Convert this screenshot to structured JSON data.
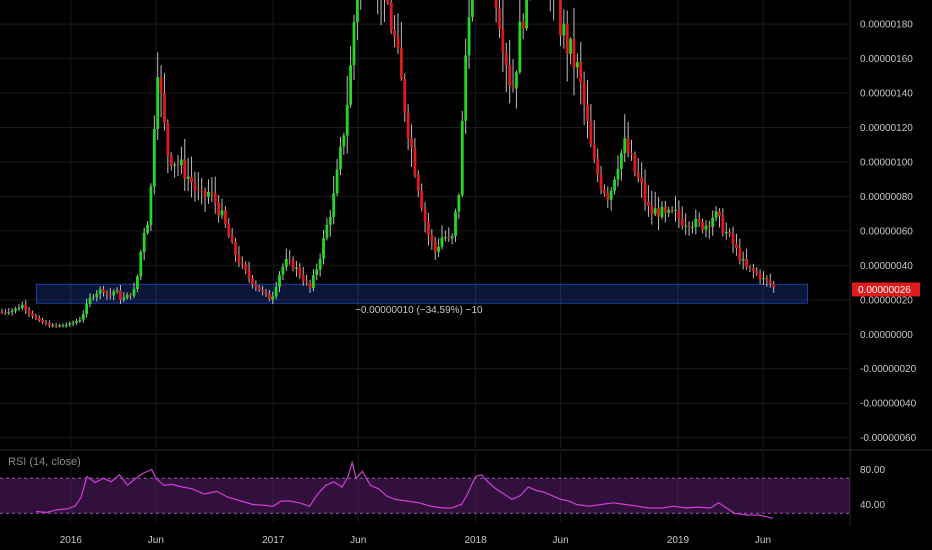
{
  "chart_data": {
    "type": "candlestick",
    "y_ticks": [
      "0.00000180",
      "0.00000160",
      "0.00000140",
      "0.00000120",
      "0.00000100",
      "0.00000080",
      "0.00000060",
      "0.00000040",
      "0.00000020",
      "0.00000000",
      "-0.00000020",
      "-0.00000040",
      "-0.00000060"
    ],
    "y_tick_values": [
      180,
      160,
      140,
      120,
      100,
      80,
      60,
      40,
      20,
      0,
      -20,
      -40,
      -60
    ],
    "ylim": [
      -66,
      194
    ],
    "x_labels": [
      "2016",
      "Jun",
      "2017",
      "Jun",
      "2018",
      "Jun",
      "2019",
      "Jun"
    ],
    "x_label_months": [
      2016.0,
      2016.42,
      2017.0,
      2017.42,
      2018.0,
      2018.42,
      2019.0,
      2019.42
    ],
    "xlim": [
      2015.65,
      2019.85
    ],
    "last_price_label": "0.00000026",
    "last_price_value": 26,
    "up_color": "#22d822",
    "down_color": "#e01b1b",
    "measure": {
      "label": "−0.00000010 (−34.59%) −10",
      "x_start": 2015.83,
      "x_end": 2019.64,
      "y_top": 29,
      "y_bottom": 18,
      "color": "#2962ff"
    },
    "close_path": [
      [
        2015.66,
        13
      ],
      [
        2015.72,
        14
      ],
      [
        2015.76,
        17
      ],
      [
        2015.8,
        12
      ],
      [
        2015.84,
        8
      ],
      [
        2015.9,
        5
      ],
      [
        2015.95,
        5
      ],
      [
        2016.0,
        6
      ],
      [
        2016.05,
        9
      ],
      [
        2016.09,
        20
      ],
      [
        2016.12,
        24
      ],
      [
        2016.16,
        26
      ],
      [
        2016.19,
        22
      ],
      [
        2016.22,
        26
      ],
      [
        2016.25,
        20
      ],
      [
        2016.28,
        22
      ],
      [
        2016.32,
        26
      ],
      [
        2016.36,
        60
      ],
      [
        2016.39,
        70
      ],
      [
        2016.41,
        120
      ],
      [
        2016.43,
        160
      ],
      [
        2016.45,
        130
      ],
      [
        2016.48,
        105
      ],
      [
        2016.52,
        100
      ],
      [
        2016.56,
        95
      ],
      [
        2016.6,
        88
      ],
      [
        2016.64,
        78
      ],
      [
        2016.68,
        82
      ],
      [
        2016.72,
        76
      ],
      [
        2016.76,
        64
      ],
      [
        2016.8,
        50
      ],
      [
        2016.85,
        38
      ],
      [
        2016.9,
        30
      ],
      [
        2016.95,
        24
      ],
      [
        2016.99,
        20
      ],
      [
        2017.03,
        35
      ],
      [
        2017.06,
        42
      ],
      [
        2017.1,
        40
      ],
      [
        2017.14,
        34
      ],
      [
        2017.18,
        26
      ],
      [
        2017.22,
        40
      ],
      [
        2017.26,
        60
      ],
      [
        2017.3,
        80
      ],
      [
        2017.34,
        110
      ],
      [
        2017.38,
        150
      ],
      [
        2017.41,
        200
      ],
      [
        2017.44,
        230
      ],
      [
        2017.48,
        220
      ],
      [
        2017.52,
        210
      ],
      [
        2017.56,
        195
      ],
      [
        2017.6,
        170
      ],
      [
        2017.64,
        140
      ],
      [
        2017.68,
        110
      ],
      [
        2017.72,
        85
      ],
      [
        2017.76,
        60
      ],
      [
        2017.8,
        48
      ],
      [
        2017.84,
        58
      ],
      [
        2017.88,
        52
      ],
      [
        2017.92,
        85
      ],
      [
        2017.95,
        160
      ],
      [
        2017.98,
        220
      ],
      [
        2018.02,
        240
      ],
      [
        2018.06,
        230
      ],
      [
        2018.1,
        200
      ],
      [
        2018.14,
        170
      ],
      [
        2018.18,
        140
      ],
      [
        2018.22,
        175
      ],
      [
        2018.26,
        210
      ],
      [
        2018.3,
        230
      ],
      [
        2018.34,
        215
      ],
      [
        2018.38,
        205
      ],
      [
        2018.42,
        180
      ],
      [
        2018.46,
        165
      ],
      [
        2018.5,
        155
      ],
      [
        2018.54,
        130
      ],
      [
        2018.58,
        100
      ],
      [
        2018.62,
        88
      ],
      [
        2018.66,
        80
      ],
      [
        2018.7,
        100
      ],
      [
        2018.74,
        110
      ],
      [
        2018.78,
        96
      ],
      [
        2018.82,
        85
      ],
      [
        2018.86,
        70
      ],
      [
        2018.9,
        72
      ],
      [
        2018.94,
        68
      ],
      [
        2018.98,
        70
      ],
      [
        2019.02,
        66
      ],
      [
        2019.06,
        66
      ],
      [
        2019.1,
        63
      ],
      [
        2019.14,
        64
      ],
      [
        2019.18,
        70
      ],
      [
        2019.22,
        62
      ],
      [
        2019.26,
        55
      ],
      [
        2019.3,
        46
      ],
      [
        2019.34,
        38
      ],
      [
        2019.38,
        36
      ],
      [
        2019.42,
        32
      ],
      [
        2019.46,
        29
      ],
      [
        2019.48,
        26
      ]
    ],
    "rsi": {
      "title": "RSI (14, close)",
      "y_ticks": [
        "80.00",
        "40.00"
      ],
      "y_tick_values": [
        80,
        40
      ],
      "upper_band": 70,
      "lower_band": 30,
      "ylim": [
        20,
        100
      ],
      "line_color": "#d23ddb",
      "band_color": "#5a1f6e",
      "values": [
        [
          2015.83,
          32
        ],
        [
          2015.88,
          31
        ],
        [
          2015.93,
          34
        ],
        [
          2015.98,
          35
        ],
        [
          2016.02,
          38
        ],
        [
          2016.05,
          48
        ],
        [
          2016.08,
          72
        ],
        [
          2016.12,
          65
        ],
        [
          2016.16,
          70
        ],
        [
          2016.2,
          66
        ],
        [
          2016.24,
          74
        ],
        [
          2016.28,
          62
        ],
        [
          2016.32,
          70
        ],
        [
          2016.36,
          76
        ],
        [
          2016.4,
          80
        ],
        [
          2016.42,
          70
        ],
        [
          2016.46,
          62
        ],
        [
          2016.5,
          63
        ],
        [
          2016.55,
          60
        ],
        [
          2016.6,
          58
        ],
        [
          2016.66,
          52
        ],
        [
          2016.72,
          55
        ],
        [
          2016.78,
          48
        ],
        [
          2016.84,
          44
        ],
        [
          2016.9,
          40
        ],
        [
          2016.96,
          39
        ],
        [
          2017.0,
          38
        ],
        [
          2017.04,
          44
        ],
        [
          2017.08,
          44
        ],
        [
          2017.13,
          42
        ],
        [
          2017.18,
          38
        ],
        [
          2017.22,
          52
        ],
        [
          2017.26,
          62
        ],
        [
          2017.3,
          66
        ],
        [
          2017.34,
          60
        ],
        [
          2017.37,
          72
        ],
        [
          2017.39,
          88
        ],
        [
          2017.41,
          70
        ],
        [
          2017.44,
          78
        ],
        [
          2017.48,
          62
        ],
        [
          2017.52,
          58
        ],
        [
          2017.56,
          50
        ],
        [
          2017.6,
          46
        ],
        [
          2017.66,
          44
        ],
        [
          2017.72,
          42
        ],
        [
          2017.78,
          38
        ],
        [
          2017.84,
          36
        ],
        [
          2017.88,
          36
        ],
        [
          2017.93,
          40
        ],
        [
          2017.96,
          52
        ],
        [
          2018.0,
          72
        ],
        [
          2018.03,
          74
        ],
        [
          2018.06,
          66
        ],
        [
          2018.1,
          58
        ],
        [
          2018.14,
          52
        ],
        [
          2018.18,
          46
        ],
        [
          2018.22,
          50
        ],
        [
          2018.26,
          60
        ],
        [
          2018.3,
          56
        ],
        [
          2018.34,
          54
        ],
        [
          2018.38,
          50
        ],
        [
          2018.42,
          46
        ],
        [
          2018.46,
          44
        ],
        [
          2018.5,
          40
        ],
        [
          2018.56,
          38
        ],
        [
          2018.62,
          40
        ],
        [
          2018.68,
          42
        ],
        [
          2018.74,
          40
        ],
        [
          2018.8,
          38
        ],
        [
          2018.86,
          36
        ],
        [
          2018.92,
          36
        ],
        [
          2018.98,
          38
        ],
        [
          2019.04,
          36
        ],
        [
          2019.1,
          37
        ],
        [
          2019.16,
          36
        ],
        [
          2019.2,
          42
        ],
        [
          2019.24,
          36
        ],
        [
          2019.28,
          30
        ],
        [
          2019.34,
          28
        ],
        [
          2019.4,
          28
        ],
        [
          2019.44,
          26
        ],
        [
          2019.47,
          24
        ]
      ]
    }
  }
}
